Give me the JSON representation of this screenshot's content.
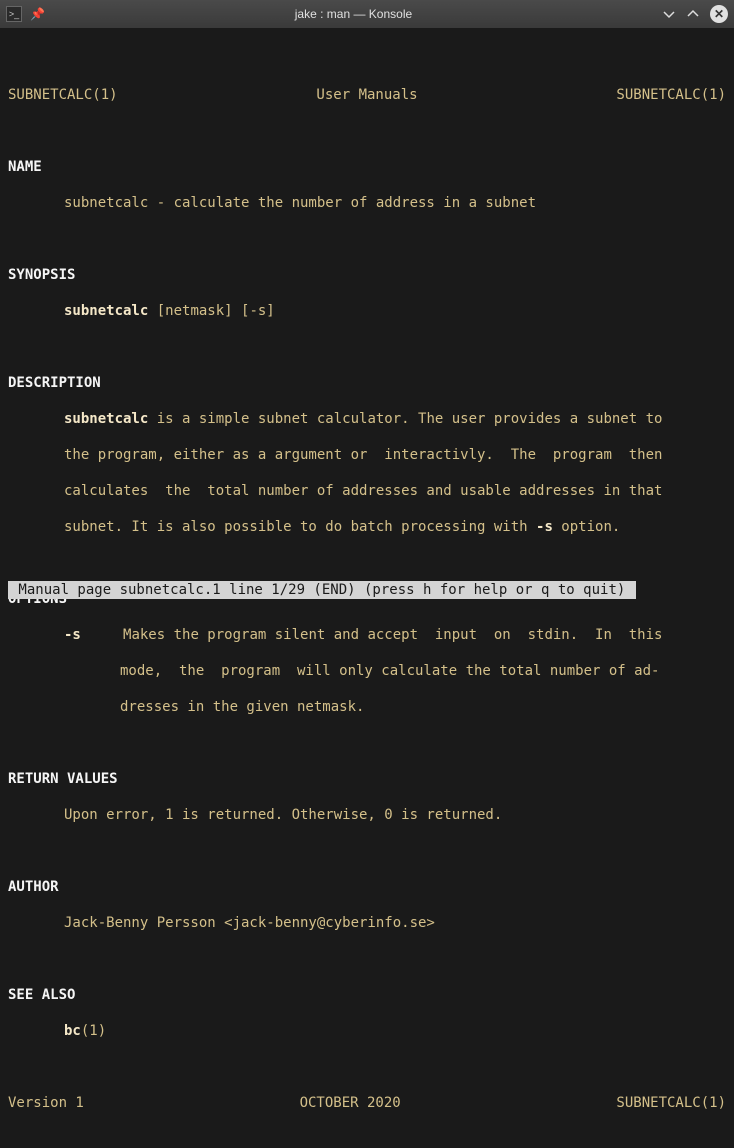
{
  "titlebar": {
    "title": "jake : man — Konsole"
  },
  "man": {
    "header_left": "SUBNETCALC(1)",
    "header_center": "User Manuals",
    "header_right": "SUBNETCALC(1)",
    "name_head": "NAME",
    "name_line": "subnetcalc - calculate the number of address in a subnet",
    "synopsis_head": "SYNOPSIS",
    "synopsis_cmd": "subnetcalc",
    "synopsis_args": " [netmask] [-s]",
    "description_head": "DESCRIPTION",
    "desc_cmd": "subnetcalc",
    "desc_line1_rest": " is a simple subnet calculator. The user provides a subnet to",
    "desc_line2": "the program, either as a argument or  interactivly.  The  program  then",
    "desc_line3": "calculates  the  total number of addresses and usable addresses in that",
    "desc_line4a": "subnet. It is also possible to do batch processing with ",
    "desc_opt": "-s",
    "desc_line4b": " option.",
    "options_head": "OPTIONS",
    "opt_flag": "-s",
    "opt_line1": "Makes the program silent and accept  input  on  stdin.  In  this",
    "opt_line2": "mode,  the  program  will only calculate the total number of ad-",
    "opt_line3": "dresses in the given netmask.",
    "return_head": "RETURN VALUES",
    "return_line": "Upon error, 1 is returned. Otherwise, 0 is returned.",
    "author_head": "AUTHOR",
    "author_line": "Jack-Benny Persson <jack-benny@cyberinfo.se>",
    "seealso_head": "SEE ALSO",
    "seealso_cmd": "bc",
    "seealso_rest": "(1)",
    "footer_left": "Version 1",
    "footer_center": "OCTOBER 2020",
    "footer_right": "SUBNETCALC(1)",
    "status": " Manual page subnetcalc.1 line 1/29 (END) (press h for help or q to quit) "
  }
}
